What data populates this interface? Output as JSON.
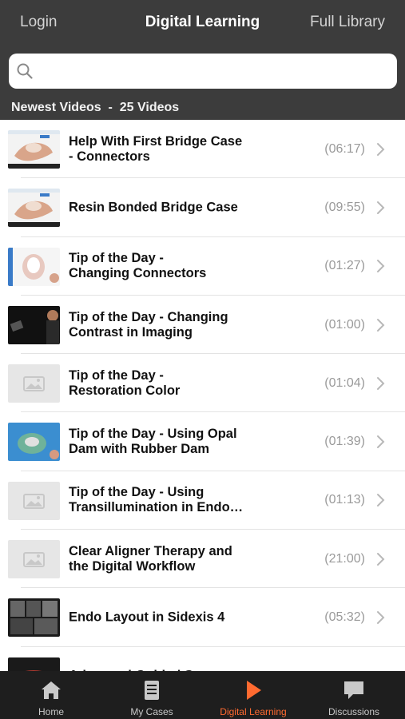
{
  "header": {
    "left": "Login",
    "title": "Digital Learning",
    "right": "Full Library"
  },
  "search": {
    "placeholder": ""
  },
  "section": {
    "title": "Newest Videos  -  25 Videos"
  },
  "videos": [
    {
      "title": "Help With First Bridge Case\n- Connectors",
      "duration": "(06:17)",
      "thumb": "bridge"
    },
    {
      "title": "Resin Bonded Bridge Case",
      "duration": "(09:55)",
      "thumb": "bridge2"
    },
    {
      "title": "Tip of the Day -\nChanging Connectors",
      "duration": "(01:27)",
      "thumb": "teeth"
    },
    {
      "title": "Tip of the Day - Changing\nContrast in Imaging",
      "duration": "(01:00)",
      "thumb": "dark"
    },
    {
      "title": "Tip of the Day -\nRestoration Color",
      "duration": "(01:04)",
      "thumb": "placeholder"
    },
    {
      "title": "Tip of the Day - Using Opal\nDam with Rubber Dam",
      "duration": "(01:39)",
      "thumb": "dam"
    },
    {
      "title": "Tip of the Day - Using\nTransillumination in Endo…",
      "duration": "(01:13)",
      "thumb": "placeholder"
    },
    {
      "title": "Clear Aligner Therapy and\nthe Digital Workflow",
      "duration": "(21:00)",
      "thumb": "placeholder"
    },
    {
      "title": "Endo Layout in Sidexis 4",
      "duration": "(05:32)",
      "thumb": "xray"
    },
    {
      "title": "Advanced Guided Surgery",
      "duration": "",
      "thumb": "surgery"
    }
  ],
  "tabs": [
    {
      "label": "Home",
      "icon": "home-icon"
    },
    {
      "label": "My Cases",
      "icon": "book-icon"
    },
    {
      "label": "Digital Learning",
      "icon": "play-icon",
      "active": true
    },
    {
      "label": "Discussions",
      "icon": "chat-icon"
    }
  ],
  "colors": {
    "bar": "#3c3c3c",
    "accent": "#ff6a30",
    "bottom": "#1e1e1e"
  }
}
